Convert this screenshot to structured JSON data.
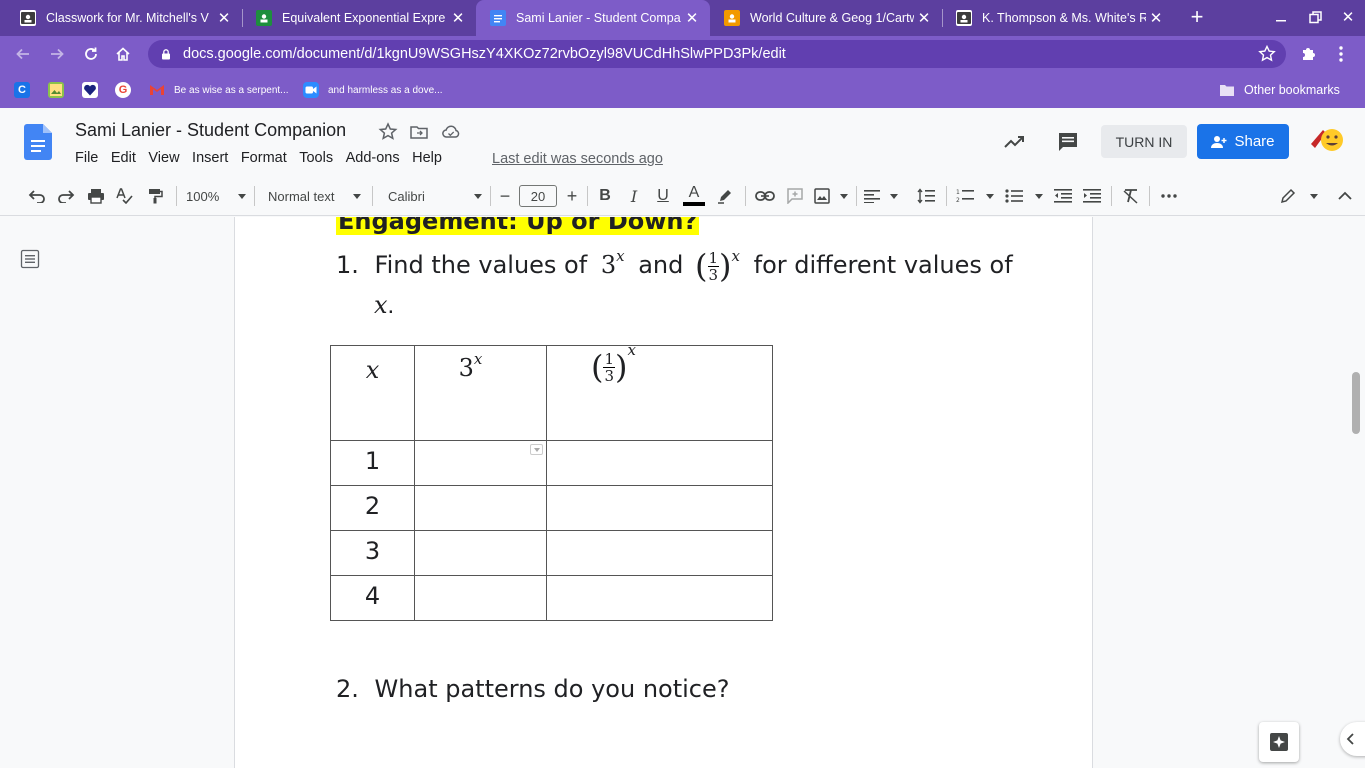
{
  "browser": {
    "tabs": [
      {
        "title": "Classwork for Mr. Mitchell's V",
        "favicon_color": "#1e8e3e"
      },
      {
        "title": "Equivalent Exponential Expre",
        "favicon_color": "#1e8e3e"
      },
      {
        "title": "Sami Lanier - Student Compa",
        "favicon_color": "#4285f4",
        "active": true
      },
      {
        "title": "World Culture & Geog 1/Cartw",
        "favicon_color": "#f29900"
      },
      {
        "title": "K. Thompson & Ms. White's R",
        "favicon_color": "#1e8e3e"
      }
    ],
    "url": "docs.google.com/document/d/1kgnU9WSGHszY4XKOz72rvbOzyl98VUCdHhSlwPPD3Pk/edit",
    "bookmarks": [
      {
        "label": "",
        "icon": "c-icon"
      },
      {
        "label": "",
        "icon": "photo-icon"
      },
      {
        "label": "",
        "icon": "heart-icon"
      },
      {
        "label": "",
        "icon": "google-icon"
      },
      {
        "label": "Be as wise as a serpent...",
        "icon": "gmail-icon"
      },
      {
        "label": "and harmless as a dove...",
        "icon": "meet-icon"
      }
    ],
    "other_bookmarks": "Other bookmarks"
  },
  "docs": {
    "title": "Sami Lanier - Student Companion",
    "menu": [
      "File",
      "Edit",
      "View",
      "Insert",
      "Format",
      "Tools",
      "Add-ons",
      "Help"
    ],
    "last_edit": "Last edit was seconds ago",
    "turn_in": "TURN IN",
    "share": "Share",
    "toolbar": {
      "zoom": "100%",
      "style": "Normal text",
      "font": "Calibri",
      "font_size": "20"
    }
  },
  "document": {
    "heading": "Engagement: Up or Down?",
    "q1": {
      "number": "1.",
      "text_a": "Find the values of",
      "and": "and",
      "text_b": "for different values of",
      "var": "x",
      "period": "."
    },
    "table": {
      "header_x": "x",
      "header_3x_base": "3",
      "header_exp": "x",
      "frac_num": "1",
      "frac_den": "3",
      "rows": [
        "1",
        "2",
        "3",
        "4"
      ]
    },
    "q2": {
      "number": "2.",
      "text": "What patterns do you notice?"
    }
  }
}
